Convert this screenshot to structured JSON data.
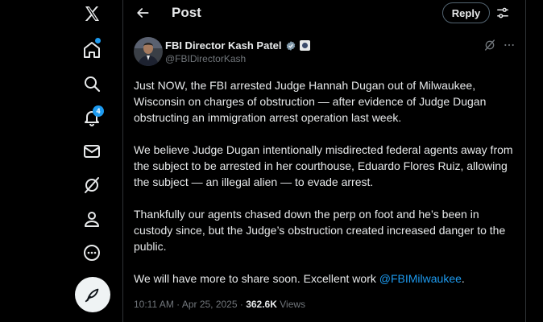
{
  "sidebar": {
    "icons": [
      "x-logo-icon",
      "home-icon",
      "explore-icon",
      "notifications-icon",
      "messages-icon",
      "grok-icon",
      "profile-icon",
      "more-icon"
    ],
    "notifications_badge": "4",
    "compose_icon": "compose-post-icon"
  },
  "header": {
    "title": "Post",
    "reply_label": "Reply"
  },
  "post": {
    "author_name": "FBI Director Kash Patel",
    "handle": "@FBIDirectorKash",
    "paragraphs": [
      "Just NOW, the FBI arrested Judge Hannah Dugan out of Milwaukee, Wisconsin on charges of obstruction — after evidence of Judge Dugan obstructing an immigration arrest operation last week.",
      "We believe Judge Dugan intentionally misdirected federal agents away from the subject to be arrested in her courthouse, Eduardo Flores Ruiz, allowing the subject — an illegal alien — to evade arrest.",
      "Thankfully our agents chased down the perp on foot and he’s been in custody since, but the Judge’s obstruction created increased danger to the public."
    ],
    "last_para_text": "We will have more to share soon. Excellent work ",
    "mention": "@FBIMilwaukee",
    "last_para_end": ".",
    "timestamp": "10:11 AM · Apr 25, 2025 · ",
    "views_count": "362.6K",
    "views_label": " Views"
  },
  "colors": {
    "background": "#000000",
    "text": "#e7e9ea",
    "muted": "#71767b",
    "accent": "#1d9bf0",
    "border": "#2f3336"
  }
}
